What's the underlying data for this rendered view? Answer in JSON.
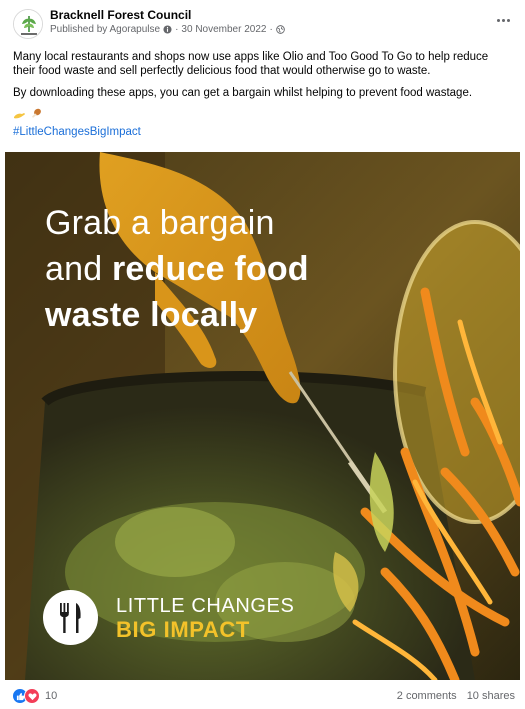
{
  "post": {
    "page_name": "Bracknell Forest Council",
    "published_by": "Published by Agorapulse",
    "date": "30 November 2022",
    "separator": "·",
    "body_paragraphs": [
      "Many local restaurants and shops now use apps like Olio and Too Good To Go to help reduce their food waste and sell perfectly delicious food that would otherwise go to waste.",
      "By downloading these apps, you can get a bargain whilst helping to prevent food wastage."
    ],
    "hashtag": "#LittleChangesBigImpact"
  },
  "image": {
    "headline_line1": "Grab a bargain",
    "headline_line2_light": "and ",
    "headline_line2_bold": "reduce food",
    "headline_line3_bold": "waste locally",
    "tagline_line1": "LITTLE CHANGES",
    "tagline_line2": "BIG IMPACT",
    "icon": "fork-knife-icon"
  },
  "footer": {
    "reaction_count": "10",
    "comments": "2 comments",
    "shares": "10 shares"
  },
  "colors": {
    "hashtag": "#1a6ed8",
    "tagline_accent": "#f3c22a",
    "like": "#1877f2",
    "love": "#f33e58"
  }
}
